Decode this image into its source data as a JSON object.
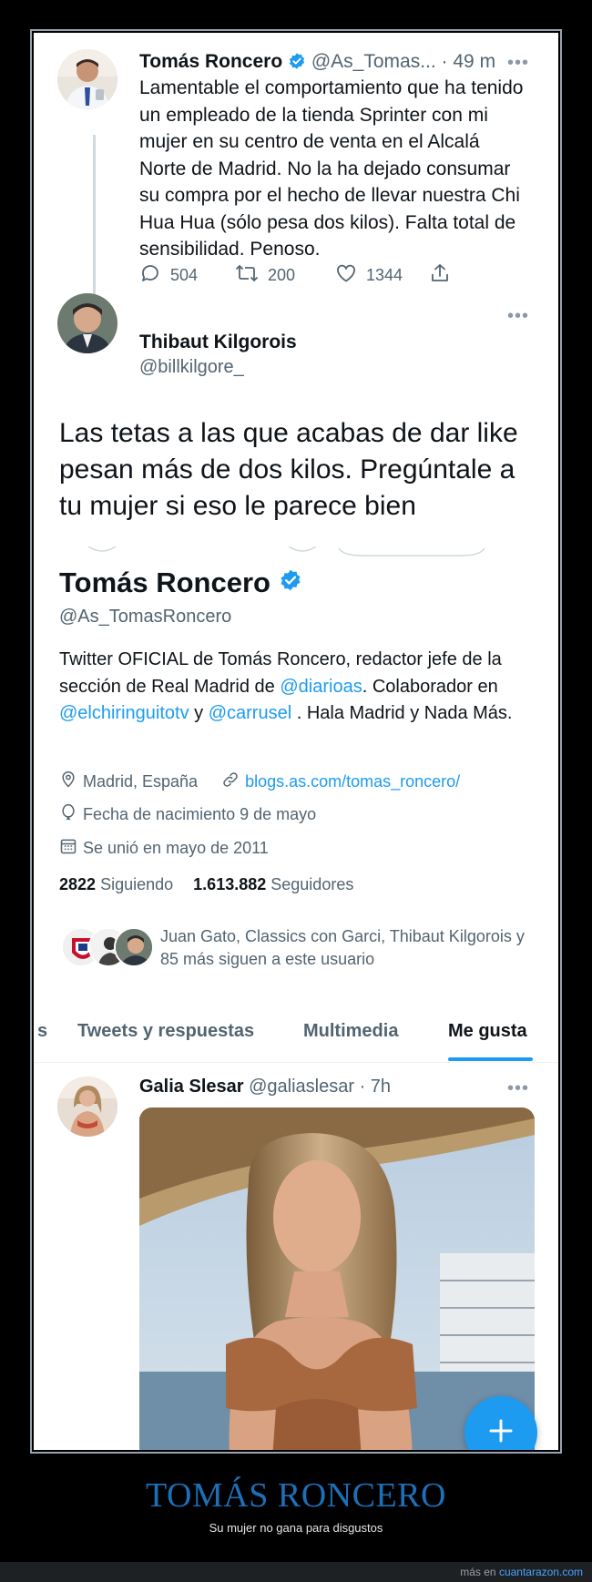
{
  "tweet1": {
    "name": "Tomás Roncero",
    "handle": "@As_Tomas...",
    "time": "· 49 m",
    "more": "•••",
    "text": "Lamentable el comportamiento que ha tenido un empleado de la tienda Sprinter con mi mujer en su centro de venta en el Alcalá Norte de Madrid. No la ha dejado consumar su compra por el hecho de llevar nuestra Chi Hua Hua (sólo pesa dos kilos). Falta total de sensibilidad. Penoso.",
    "replies": "504",
    "retweets": "200",
    "likes": "1344"
  },
  "tweet2": {
    "name": "Thibaut Kilgorois",
    "handle": "@billkilgore_",
    "more": "•••",
    "text": "Las tetas a las que acabas de dar like pesan más de dos kilos. Pregúntale a tu mujer si eso le parece bien"
  },
  "profile": {
    "name": "Tomás Roncero",
    "handle": "@As_TomasRoncero",
    "bio_1": "Twitter OFICIAL de Tomás Roncero, redactor jefe de la sección de Real Madrid de ",
    "bio_link_1": "@diarioas",
    "bio_2": ". Colaborador en ",
    "bio_link_2": "@elchiringuitotv",
    "bio_3": " y ",
    "bio_link_3": "@carrusel",
    "bio_4": " . Hala Madrid y Nada Más.",
    "location": "Madrid, España",
    "website": "blogs.as.com/tomas_roncero/",
    "birthday": "Fecha de nacimiento 9 de mayo",
    "joined": "Se unió en mayo de 2011",
    "following_count": "2822",
    "following_label": "Siguiendo",
    "followers_count": "1.613.882",
    "followers_label": "Seguidores",
    "known_followers": "Juan Gato, Classics con Garci, Thibaut Kilgorois y 85 más siguen a este usuario"
  },
  "tabs": [
    {
      "label": "s"
    },
    {
      "label": "Tweets y respuestas"
    },
    {
      "label": "Multimedia"
    },
    {
      "label": "Me gusta",
      "active": true
    }
  ],
  "tweet3": {
    "name": "Galia Slesar",
    "handle": "@galiaslesar",
    "time": "· 7h",
    "more": "•••"
  },
  "caption": {
    "title": "TOMÁS RONCERO",
    "subtitle": "Su mujer no gana para disgustos",
    "footer_prefix": "más en ",
    "footer_link": "cuantarazon.com"
  },
  "colors": {
    "accent": "#1d9bf0",
    "caption_title": "#1d6fb8",
    "background": "#000000"
  }
}
